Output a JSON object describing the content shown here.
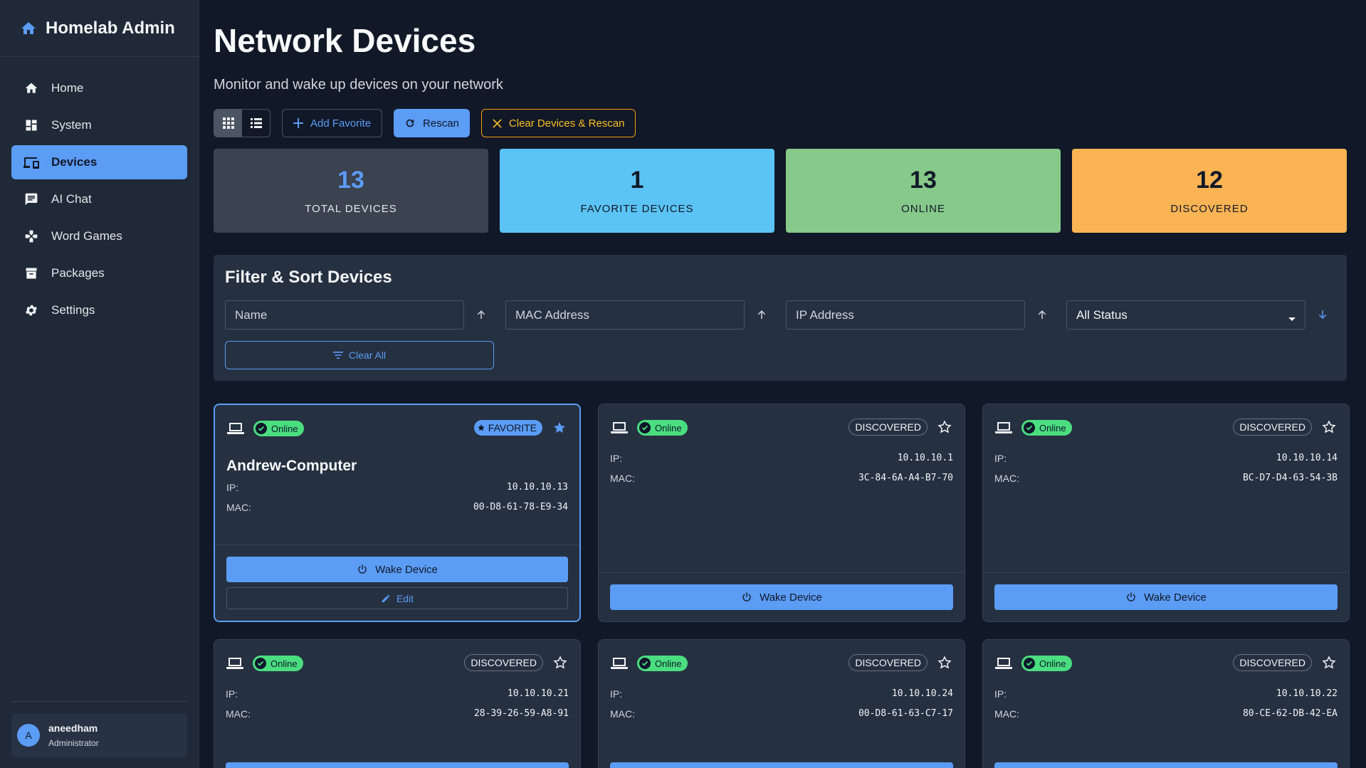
{
  "brand": {
    "title": "Homelab Admin",
    "icon": "home-icon"
  },
  "nav": [
    {
      "label": "Home",
      "icon": "home-icon",
      "active": false
    },
    {
      "label": "System",
      "icon": "dashboard-icon",
      "active": false
    },
    {
      "label": "Devices",
      "icon": "devices-icon",
      "active": true
    },
    {
      "label": "AI Chat",
      "icon": "chat-icon",
      "active": false
    },
    {
      "label": "Word Games",
      "icon": "gamepad-icon",
      "active": false
    },
    {
      "label": "Packages",
      "icon": "archive-icon",
      "active": false
    },
    {
      "label": "Settings",
      "icon": "gear-icon",
      "active": false
    }
  ],
  "user": {
    "initial": "A",
    "name": "aneedham",
    "role": "Administrator"
  },
  "page": {
    "title": "Network Devices",
    "subtitle": "Monitor and wake up devices on your network"
  },
  "toolbar": {
    "add_favorite": "Add Favorite",
    "rescan": "Rescan",
    "clear_rescan": "Clear Devices & Rescan"
  },
  "stats": [
    {
      "value": "13",
      "label": "TOTAL DEVICES",
      "bg": "#3b4250",
      "fg": "#5b9cf5",
      "labelColor": "#e5e7eb"
    },
    {
      "value": "1",
      "label": "FAVORITE DEVICES",
      "bg": "#5bc4f5",
      "fg": "#111827",
      "labelColor": "#111827"
    },
    {
      "value": "13",
      "label": "ONLINE",
      "bg": "#86c98a",
      "fg": "#111827",
      "labelColor": "#111827"
    },
    {
      "value": "12",
      "label": "DISCOVERED",
      "bg": "#fbb454",
      "fg": "#111827",
      "labelColor": "#111827"
    }
  ],
  "filter": {
    "title": "Filter & Sort Devices",
    "name_placeholder": "Name",
    "mac_placeholder": "MAC Address",
    "ip_placeholder": "IP Address",
    "status_value": "All Status",
    "clear_all": "Clear All"
  },
  "device_labels": {
    "ip": "IP:",
    "mac": "MAC:",
    "wake": "Wake Device",
    "edit": "Edit",
    "online": "Online",
    "discovered": "DISCOVERED",
    "favorite": "FAVORITE"
  },
  "devices": [
    {
      "name": "Andrew-Computer",
      "ip": "10.10.10.13",
      "mac": "00-D8-61-78-E9-34",
      "favorite": true
    },
    {
      "name": "",
      "ip": "10.10.10.1",
      "mac": "3C-84-6A-A4-B7-70",
      "favorite": false
    },
    {
      "name": "",
      "ip": "10.10.10.14",
      "mac": "BC-D7-D4-63-54-3B",
      "favorite": false
    },
    {
      "name": "",
      "ip": "10.10.10.21",
      "mac": "28-39-26-59-A8-91",
      "favorite": false
    },
    {
      "name": "",
      "ip": "10.10.10.24",
      "mac": "00-D8-61-63-C7-17",
      "favorite": false
    },
    {
      "name": "",
      "ip": "10.10.10.22",
      "mac": "80-CE-62-DB-42-EA",
      "favorite": false
    }
  ],
  "colors": {
    "accent": "#5b9cf5",
    "online": "#4ade80",
    "warning": "#f59e0b",
    "bg": "#111827",
    "panel": "#253041"
  }
}
